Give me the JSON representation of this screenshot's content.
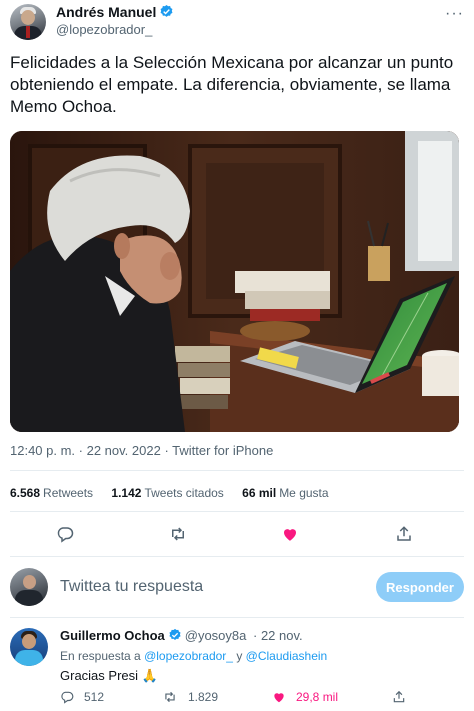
{
  "tweet": {
    "author_name": "Andrés Manuel",
    "author_handle": "@lopezobrador_",
    "text": "Felicidades a la Selección Mexicana por alcanzar un punto obteniendo el empate. La diferencia, obviamente, se llama Memo Ochoa.",
    "time": "12:40 p. m.",
    "separator": " · ",
    "date": "22 nov. 2022",
    "source": "Twitter for iPhone"
  },
  "stats": {
    "retweets_count": "6.568",
    "retweets_label": "Retweets",
    "quotes_count": "1.142",
    "quotes_label": "Tweets citados",
    "likes_count": "66 mil",
    "likes_label": "Me gusta"
  },
  "icons": {
    "reply": "reply-icon",
    "retweet": "retweet-icon",
    "like": "heart-icon",
    "share": "share-icon",
    "verified": "verified-badge-icon",
    "more": "more-icon"
  },
  "colors": {
    "like": "#f91880",
    "link": "#1d9bf0",
    "button": "#8ecdf8",
    "muted": "#536471"
  },
  "reply_box": {
    "placeholder": "Twittea tu respuesta",
    "button_label": "Responder"
  },
  "reply": {
    "author_name": "Guillermo Ochoa",
    "author_handle": "@yosoy8a",
    "date": "· 22 nov.",
    "in_reply_prefix": "En respuesta a",
    "mention1": "@lopezobrador_",
    "conjunction": "y",
    "mention2": "@Claudiashein",
    "text": "Gracias Presi 🙏",
    "replies_count": "512",
    "retweets_count": "1.829",
    "likes_count": "29,8 mil"
  }
}
